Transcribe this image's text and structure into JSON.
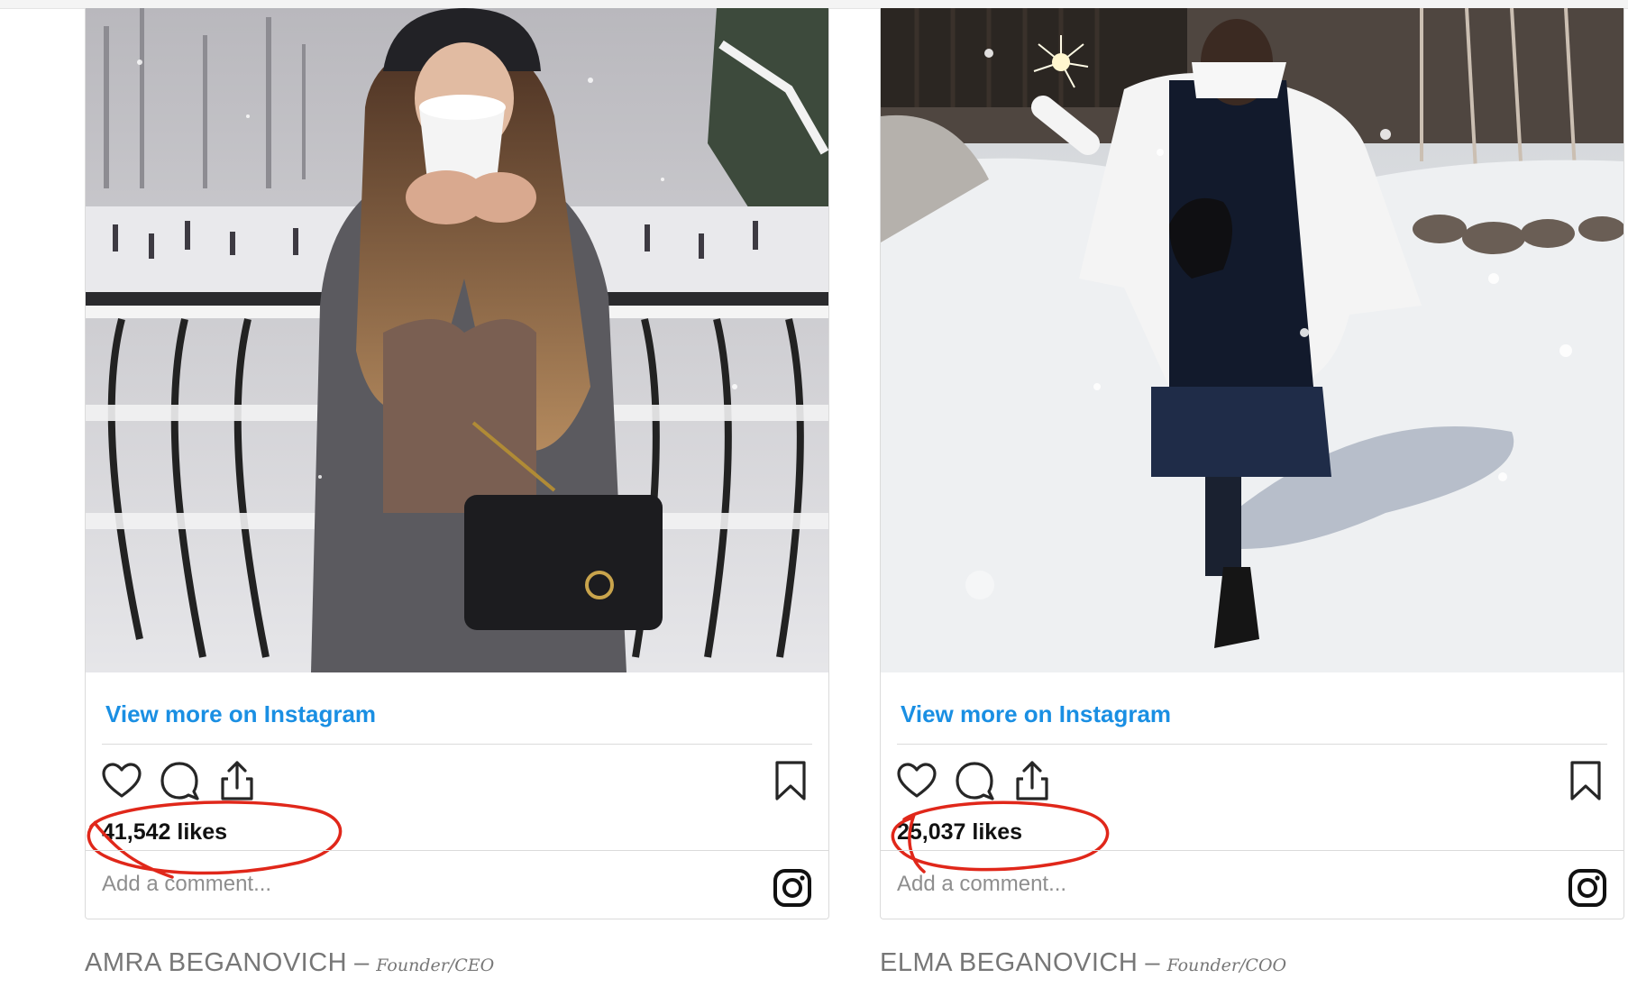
{
  "posts": [
    {
      "photo_alt": "Woman in grey coat with fur scarf drinking from a white cup beside a snowy railing overlooking a skating rink",
      "view_more": "View more on Instagram",
      "likes": "41,542 likes",
      "comment_placeholder": "Add a comment...",
      "author": "AMRA BEGANOVICH",
      "separator": "–",
      "role": "Founder/CEO"
    },
    {
      "photo_alt": "Woman in white and black jacket holding a sparkler while walking through snow",
      "view_more": "View more on Instagram",
      "likes": "25,037 likes",
      "comment_placeholder": "Add a comment...",
      "author": "ELMA BEGANOVICH",
      "separator": "–",
      "role": "Founder/COO"
    }
  ],
  "colors": {
    "link": "#1a8fe3",
    "annotation": "#e0271a",
    "caption": "#777777"
  },
  "icons": [
    "heart-icon",
    "comment-icon",
    "share-icon",
    "bookmark-icon",
    "instagram-icon"
  ]
}
